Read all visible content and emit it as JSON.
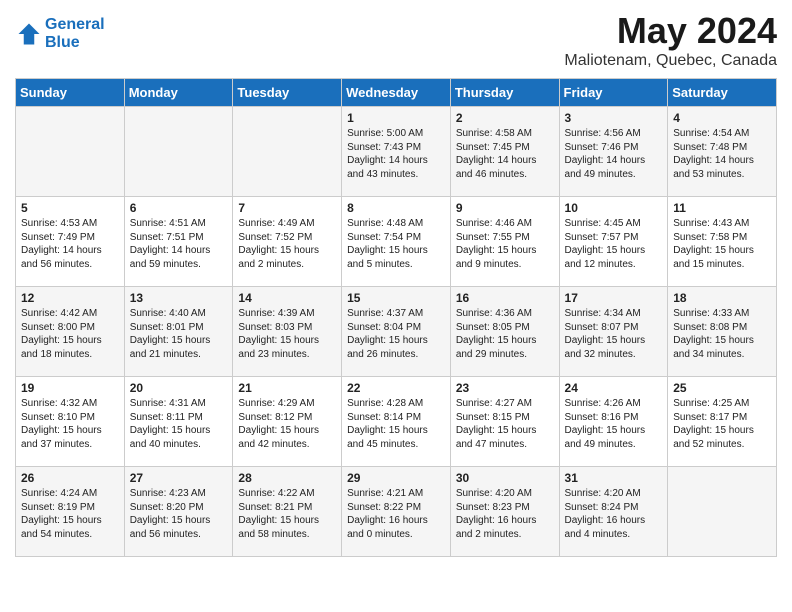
{
  "header": {
    "logo_line1": "General",
    "logo_line2": "Blue",
    "title": "May 2024",
    "subtitle": "Maliotenam, Quebec, Canada"
  },
  "weekdays": [
    "Sunday",
    "Monday",
    "Tuesday",
    "Wednesday",
    "Thursday",
    "Friday",
    "Saturday"
  ],
  "weeks": [
    [
      {
        "day": "",
        "info": ""
      },
      {
        "day": "",
        "info": ""
      },
      {
        "day": "",
        "info": ""
      },
      {
        "day": "1",
        "info": "Sunrise: 5:00 AM\nSunset: 7:43 PM\nDaylight: 14 hours\nand 43 minutes."
      },
      {
        "day": "2",
        "info": "Sunrise: 4:58 AM\nSunset: 7:45 PM\nDaylight: 14 hours\nand 46 minutes."
      },
      {
        "day": "3",
        "info": "Sunrise: 4:56 AM\nSunset: 7:46 PM\nDaylight: 14 hours\nand 49 minutes."
      },
      {
        "day": "4",
        "info": "Sunrise: 4:54 AM\nSunset: 7:48 PM\nDaylight: 14 hours\nand 53 minutes."
      }
    ],
    [
      {
        "day": "5",
        "info": "Sunrise: 4:53 AM\nSunset: 7:49 PM\nDaylight: 14 hours\nand 56 minutes."
      },
      {
        "day": "6",
        "info": "Sunrise: 4:51 AM\nSunset: 7:51 PM\nDaylight: 14 hours\nand 59 minutes."
      },
      {
        "day": "7",
        "info": "Sunrise: 4:49 AM\nSunset: 7:52 PM\nDaylight: 15 hours\nand 2 minutes."
      },
      {
        "day": "8",
        "info": "Sunrise: 4:48 AM\nSunset: 7:54 PM\nDaylight: 15 hours\nand 5 minutes."
      },
      {
        "day": "9",
        "info": "Sunrise: 4:46 AM\nSunset: 7:55 PM\nDaylight: 15 hours\nand 9 minutes."
      },
      {
        "day": "10",
        "info": "Sunrise: 4:45 AM\nSunset: 7:57 PM\nDaylight: 15 hours\nand 12 minutes."
      },
      {
        "day": "11",
        "info": "Sunrise: 4:43 AM\nSunset: 7:58 PM\nDaylight: 15 hours\nand 15 minutes."
      }
    ],
    [
      {
        "day": "12",
        "info": "Sunrise: 4:42 AM\nSunset: 8:00 PM\nDaylight: 15 hours\nand 18 minutes."
      },
      {
        "day": "13",
        "info": "Sunrise: 4:40 AM\nSunset: 8:01 PM\nDaylight: 15 hours\nand 21 minutes."
      },
      {
        "day": "14",
        "info": "Sunrise: 4:39 AM\nSunset: 8:03 PM\nDaylight: 15 hours\nand 23 minutes."
      },
      {
        "day": "15",
        "info": "Sunrise: 4:37 AM\nSunset: 8:04 PM\nDaylight: 15 hours\nand 26 minutes."
      },
      {
        "day": "16",
        "info": "Sunrise: 4:36 AM\nSunset: 8:05 PM\nDaylight: 15 hours\nand 29 minutes."
      },
      {
        "day": "17",
        "info": "Sunrise: 4:34 AM\nSunset: 8:07 PM\nDaylight: 15 hours\nand 32 minutes."
      },
      {
        "day": "18",
        "info": "Sunrise: 4:33 AM\nSunset: 8:08 PM\nDaylight: 15 hours\nand 34 minutes."
      }
    ],
    [
      {
        "day": "19",
        "info": "Sunrise: 4:32 AM\nSunset: 8:10 PM\nDaylight: 15 hours\nand 37 minutes."
      },
      {
        "day": "20",
        "info": "Sunrise: 4:31 AM\nSunset: 8:11 PM\nDaylight: 15 hours\nand 40 minutes."
      },
      {
        "day": "21",
        "info": "Sunrise: 4:29 AM\nSunset: 8:12 PM\nDaylight: 15 hours\nand 42 minutes."
      },
      {
        "day": "22",
        "info": "Sunrise: 4:28 AM\nSunset: 8:14 PM\nDaylight: 15 hours\nand 45 minutes."
      },
      {
        "day": "23",
        "info": "Sunrise: 4:27 AM\nSunset: 8:15 PM\nDaylight: 15 hours\nand 47 minutes."
      },
      {
        "day": "24",
        "info": "Sunrise: 4:26 AM\nSunset: 8:16 PM\nDaylight: 15 hours\nand 49 minutes."
      },
      {
        "day": "25",
        "info": "Sunrise: 4:25 AM\nSunset: 8:17 PM\nDaylight: 15 hours\nand 52 minutes."
      }
    ],
    [
      {
        "day": "26",
        "info": "Sunrise: 4:24 AM\nSunset: 8:19 PM\nDaylight: 15 hours\nand 54 minutes."
      },
      {
        "day": "27",
        "info": "Sunrise: 4:23 AM\nSunset: 8:20 PM\nDaylight: 15 hours\nand 56 minutes."
      },
      {
        "day": "28",
        "info": "Sunrise: 4:22 AM\nSunset: 8:21 PM\nDaylight: 15 hours\nand 58 minutes."
      },
      {
        "day": "29",
        "info": "Sunrise: 4:21 AM\nSunset: 8:22 PM\nDaylight: 16 hours\nand 0 minutes."
      },
      {
        "day": "30",
        "info": "Sunrise: 4:20 AM\nSunset: 8:23 PM\nDaylight: 16 hours\nand 2 minutes."
      },
      {
        "day": "31",
        "info": "Sunrise: 4:20 AM\nSunset: 8:24 PM\nDaylight: 16 hours\nand 4 minutes."
      },
      {
        "day": "",
        "info": ""
      }
    ]
  ]
}
